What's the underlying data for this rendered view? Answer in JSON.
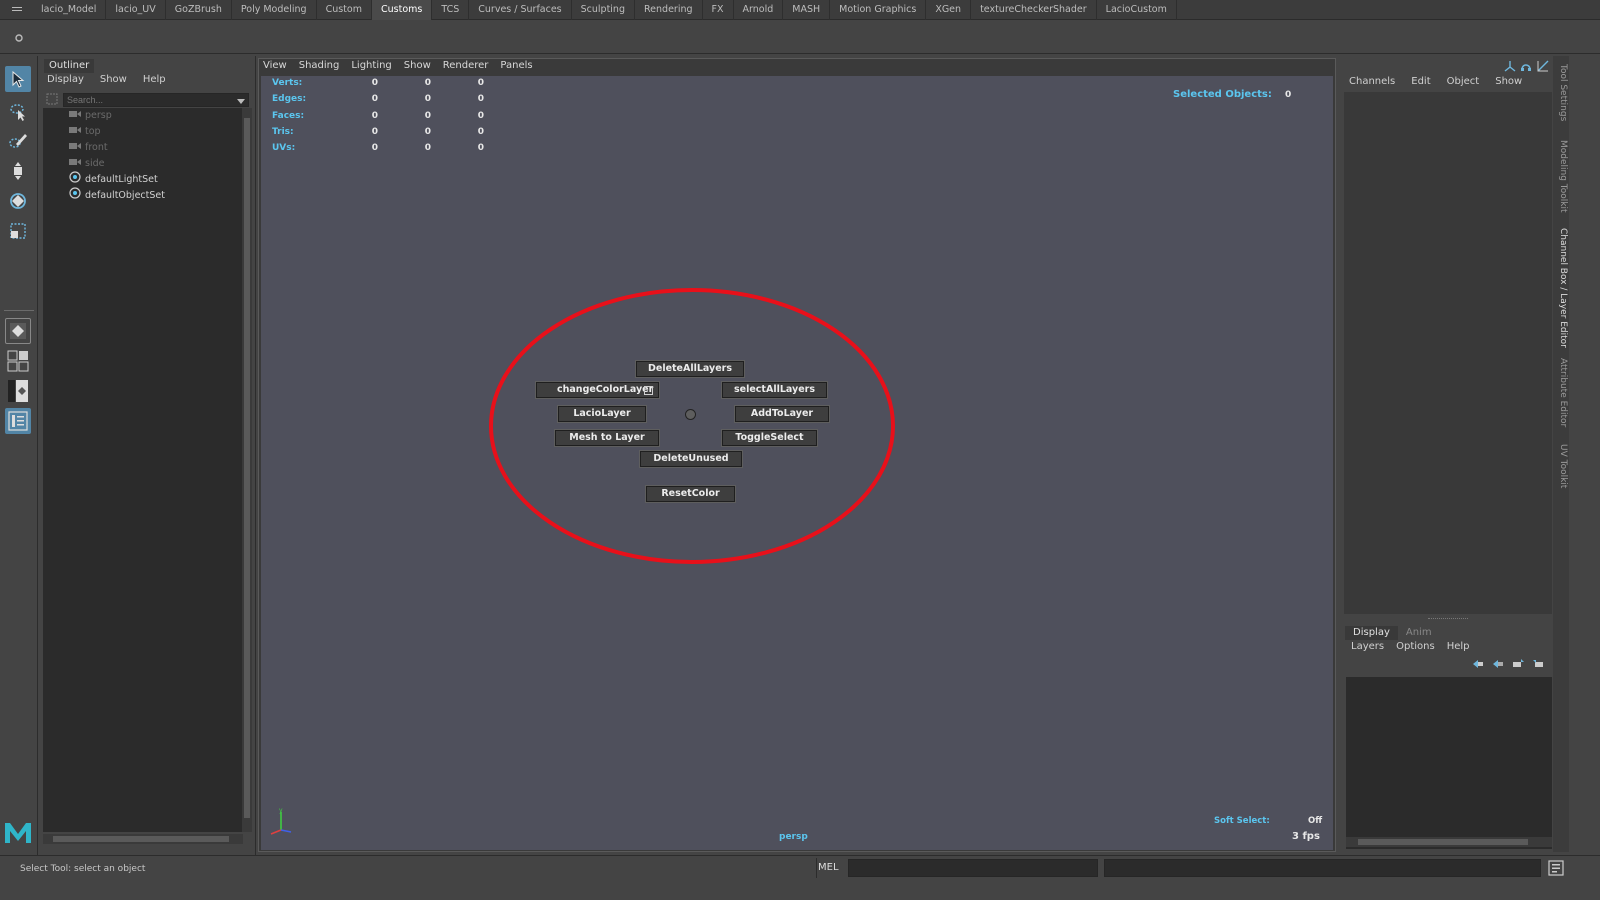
{
  "shelf_tabs": [
    "lacio_Model",
    "lacio_UV",
    "GoZBrush",
    "Poly Modeling",
    "Custom",
    "Customs",
    "TCS",
    "Curves / Surfaces",
    "Sculpting",
    "Rendering",
    "FX",
    "Arnold",
    "MASH",
    "Motion Graphics",
    "XGen",
    "textureCheckerShader",
    "LacioCustom"
  ],
  "active_shelf_tab": "Customs",
  "outliner": {
    "title": "Outliner",
    "menu": [
      "Display",
      "Show",
      "Help"
    ],
    "search_placeholder": "Search...",
    "items": [
      {
        "label": "persp",
        "icon": "camera-icon"
      },
      {
        "label": "top",
        "icon": "camera-icon"
      },
      {
        "label": "front",
        "icon": "camera-icon"
      },
      {
        "label": "side",
        "icon": "camera-icon"
      },
      {
        "label": "defaultLightSet",
        "icon": "set-icon"
      },
      {
        "label": "defaultObjectSet",
        "icon": "set-icon"
      }
    ]
  },
  "viewport": {
    "menu": [
      "View",
      "Shading",
      "Lighting",
      "Show",
      "Renderer",
      "Panels"
    ],
    "stats": [
      {
        "label": "Verts:",
        "values": [
          "0",
          "0",
          "0"
        ]
      },
      {
        "label": "Edges:",
        "values": [
          "0",
          "0",
          "0"
        ]
      },
      {
        "label": "Faces:",
        "values": [
          "0",
          "0",
          "0"
        ]
      },
      {
        "label": "Tris:",
        "values": [
          "0",
          "0",
          "0"
        ]
      },
      {
        "label": "UVs:",
        "values": [
          "0",
          "0",
          "0"
        ]
      }
    ],
    "selected_objects_label": "Selected Objects:",
    "selected_objects_value": "0",
    "camera_name": "persp",
    "soft_select_label": "Soft Select:",
    "soft_select_value": "Off",
    "fps": "3 fps",
    "marking_menu": {
      "north": "DeleteAllLayers",
      "northwest": "changeColorLayer",
      "northeast": "selectAllLayers",
      "west": "LacioLayer",
      "east": "AddToLayer",
      "southwest": "Mesh to Layer",
      "southeast": "ToggleSelect",
      "south": "DeleteUnused",
      "extra": "ResetColor"
    },
    "highlight_color": "#e8101a"
  },
  "channel_box": {
    "menu": [
      "Channels",
      "Edit",
      "Object",
      "Show"
    ]
  },
  "layer_editor": {
    "tabs": [
      "Display",
      "Anim"
    ],
    "active_tab": "Display",
    "menu": [
      "Layers",
      "Options",
      "Help"
    ]
  },
  "side_tabs": [
    "Tool Settings",
    "Modeling Toolkit",
    "Channel Box / Layer Editor",
    "Attribute Editor",
    "UV Toolkit"
  ],
  "status": {
    "help_line": "Select Tool: select an object",
    "mel_label": "MEL"
  },
  "colors": {
    "accent": "#5285a6",
    "hud_label": "#5bc6ef",
    "viewport_bg": "#4f505c",
    "maya_logo": "#2fb5c9"
  }
}
